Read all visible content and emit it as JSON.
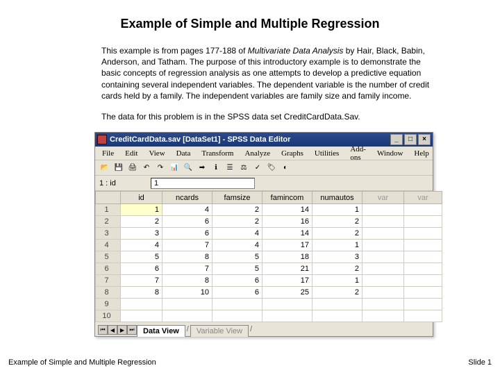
{
  "slide": {
    "title": "Example of Simple and Multiple Regression",
    "para1_a": "This example is from pages 177-188 of ",
    "para1_b": "Multivariate Data Analysis",
    "para1_c": " by Hair, Black, Babin, Anderson, and Tatham. The purpose of this introductory example is to demonstrate the basic concepts of regression analysis as one attempts to develop a predictive equation containing several independent variables. The dependent variable is the number of credit cards held by a family. The independent variables are family size and family income.",
    "para2": "The data for this problem is in the SPSS data set CreditCardData.Sav."
  },
  "spss": {
    "window_title": "CreditCardData.sav [DataSet1] - SPSS Data Editor",
    "menus": [
      "File",
      "Edit",
      "View",
      "Data",
      "Transform",
      "Analyze",
      "Graphs",
      "Utilities",
      "Add-ons",
      "Window",
      "Help"
    ],
    "cell_ref": "1 : id",
    "cell_val": "1",
    "columns": [
      "id",
      "ncards",
      "famsize",
      "famincom",
      "numautos"
    ],
    "disabled_cols": [
      "var",
      "var"
    ],
    "rows": [
      {
        "n": "1",
        "id": "1",
        "ncards": "4",
        "famsize": "2",
        "famincom": "14",
        "numautos": "1"
      },
      {
        "n": "2",
        "id": "2",
        "ncards": "6",
        "famsize": "2",
        "famincom": "16",
        "numautos": "2"
      },
      {
        "n": "3",
        "id": "3",
        "ncards": "6",
        "famsize": "4",
        "famincom": "14",
        "numautos": "2"
      },
      {
        "n": "4",
        "id": "4",
        "ncards": "7",
        "famsize": "4",
        "famincom": "17",
        "numautos": "1"
      },
      {
        "n": "5",
        "id": "5",
        "ncards": "8",
        "famsize": "5",
        "famincom": "18",
        "numautos": "3"
      },
      {
        "n": "6",
        "id": "6",
        "ncards": "7",
        "famsize": "5",
        "famincom": "21",
        "numautos": "2"
      },
      {
        "n": "7",
        "id": "7",
        "ncards": "8",
        "famsize": "6",
        "famincom": "17",
        "numautos": "1"
      },
      {
        "n": "8",
        "id": "8",
        "ncards": "10",
        "famsize": "6",
        "famincom": "25",
        "numautos": "2"
      },
      {
        "n": "9",
        "id": "",
        "ncards": "",
        "famsize": "",
        "famincom": "",
        "numautos": ""
      },
      {
        "n": "10",
        "id": "",
        "ncards": "",
        "famsize": "",
        "famincom": "",
        "numautos": ""
      }
    ],
    "tabs": {
      "active": "Data View",
      "inactive": "Variable View"
    }
  },
  "footer": {
    "left": "Example of Simple and Multiple Regression",
    "right": "Slide 1"
  }
}
